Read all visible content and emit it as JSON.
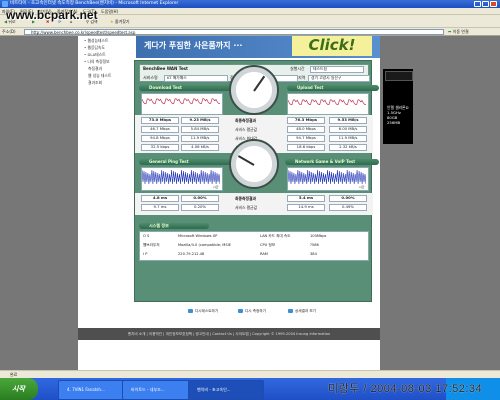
{
  "window": {
    "title": "비트타이 - 초고속인터넷 속도측정 BenchBee(벤치비) - Microsoft Internet Explorer"
  },
  "watermark": "www.bcpark.net",
  "menu": [
    "파일(F)",
    "편집(E)",
    "보기(V)",
    "즐겨찾기(A)",
    "도구(T)",
    "도움말(H)"
  ],
  "toolbar": {
    "back": "뒤로",
    "search": "검색",
    "favorites": "즐겨찾기"
  },
  "address": {
    "label": "주소(D)",
    "url": "http://www.benchbee.co.kr/speedtest/speedtest.asp",
    "go": "이동",
    "links": "연결"
  },
  "leftnav": [
    "웹성능테스트",
    "웹응답속도",
    "DLA테스트",
    "나의 측정정보",
    "측정결과",
    "웹 성능 테스트",
    "결과조회"
  ],
  "banner": {
    "text": "게다가 푸짐한 사은품까지 ···",
    "click": "Click!"
  },
  "test_header": {
    "title": "BenchBee WAN Test",
    "time_label": "실행시간",
    "time_value": "테스트됨",
    "provider_label": "서비스명",
    "provider_value": "KT 메가패스",
    "location_label": "장소",
    "location_value": "집",
    "region_label": "지역",
    "region_value": "경기 고양시 일산구"
  },
  "download": {
    "title": "Download Test",
    "axis": "시간"
  },
  "upload": {
    "title": "Upload Test",
    "axis": "시간"
  },
  "speed_stats": {
    "rows": [
      {
        "label": "최종측정결과",
        "down_mbps": "73.0 Mbps",
        "down_mb": "9.23 MB/s",
        "up_mbps": "76.3 Mbps",
        "up_mb": "9.53 MB/s"
      },
      {
        "label": "서비스 평균값",
        "down_mbps": "46.7 Mbps",
        "down_mb": "5.84 MB/s",
        "up_mbps": "48.0 Mbps",
        "up_mb": "6.00 MB/s"
      },
      {
        "label": "서비스 최대값",
        "down_mbps": "94.8 Mbps",
        "down_mb": "11.9 MB/s",
        "up_mbps": "94.7 Mbps",
        "up_mb": "11.9 MB/s"
      },
      {
        "label": "서비스 최소값",
        "down_mbps": "32.5 kbps",
        "down_mb": "4.06 kB/s",
        "up_mbps": "18.6 kbps",
        "up_mb": "2.32 kB/s"
      }
    ]
  },
  "ping": {
    "title": "General Ping Test",
    "axis": "시간"
  },
  "netgame": {
    "title": "Network Game & VoIP Test",
    "axis": "시간"
  },
  "ping_stats": {
    "rows": [
      {
        "label": "최종측정결과",
        "ping_ms": "4.8 ms",
        "ping_loss": "0.00%",
        "game_ms": "5.4 ms",
        "game_loss": "0.00%"
      },
      {
        "label": "서비스 평균값",
        "ping_ms": "9.7 ms",
        "ping_loss": "0.20%",
        "game_ms": "14.9 ms",
        "game_loss": "0.49%"
      }
    ]
  },
  "sysinfo": {
    "title": "시스템 정보",
    "os_label": "O S",
    "os_value": "Microsoft Windows XP",
    "browser_label": "웹브라우저",
    "browser_value": "Mozilla/4.0 (compatible; MSIE",
    "ip_label": "I P",
    "ip_value": "220.79.212.48",
    "lan_label": "LAN 카드 최대 속도",
    "lan_value": "100Mbps",
    "cpu_label": "CPU 정보",
    "cpu_value": "?586",
    "ram_label": "RAM",
    "ram_value": "384"
  },
  "buttons": [
    "다시테스트하기",
    "다시 측정하기",
    "상세결과 보기"
  ],
  "footer": "벤치비 소개 | 이용약관 | 개인정보보호정책 | 광고안내 | Contact Us | 사이트맵 | Copyright © 1999-2004 Insung Information",
  "ad": {
    "line1": "인텔 셀러론D",
    "line2": "1.5GHz",
    "line3": "80GB",
    "line4": "256MB"
  },
  "status": {
    "text": "완료"
  },
  "taskbar": {
    "start": "시작",
    "tasks": [
      "4. 7VIN1 Fanatsh...",
      "바이토드 - 내부조...",
      "벤치비 - 초고속인..."
    ]
  },
  "timestamp": "미랑두 / 2004-08-03 17:52:34",
  "colors": {
    "panel": "#5a8f77",
    "download_line": "#c0395a",
    "ping_line": "#2436b8",
    "taskbar": "#2458d4"
  }
}
